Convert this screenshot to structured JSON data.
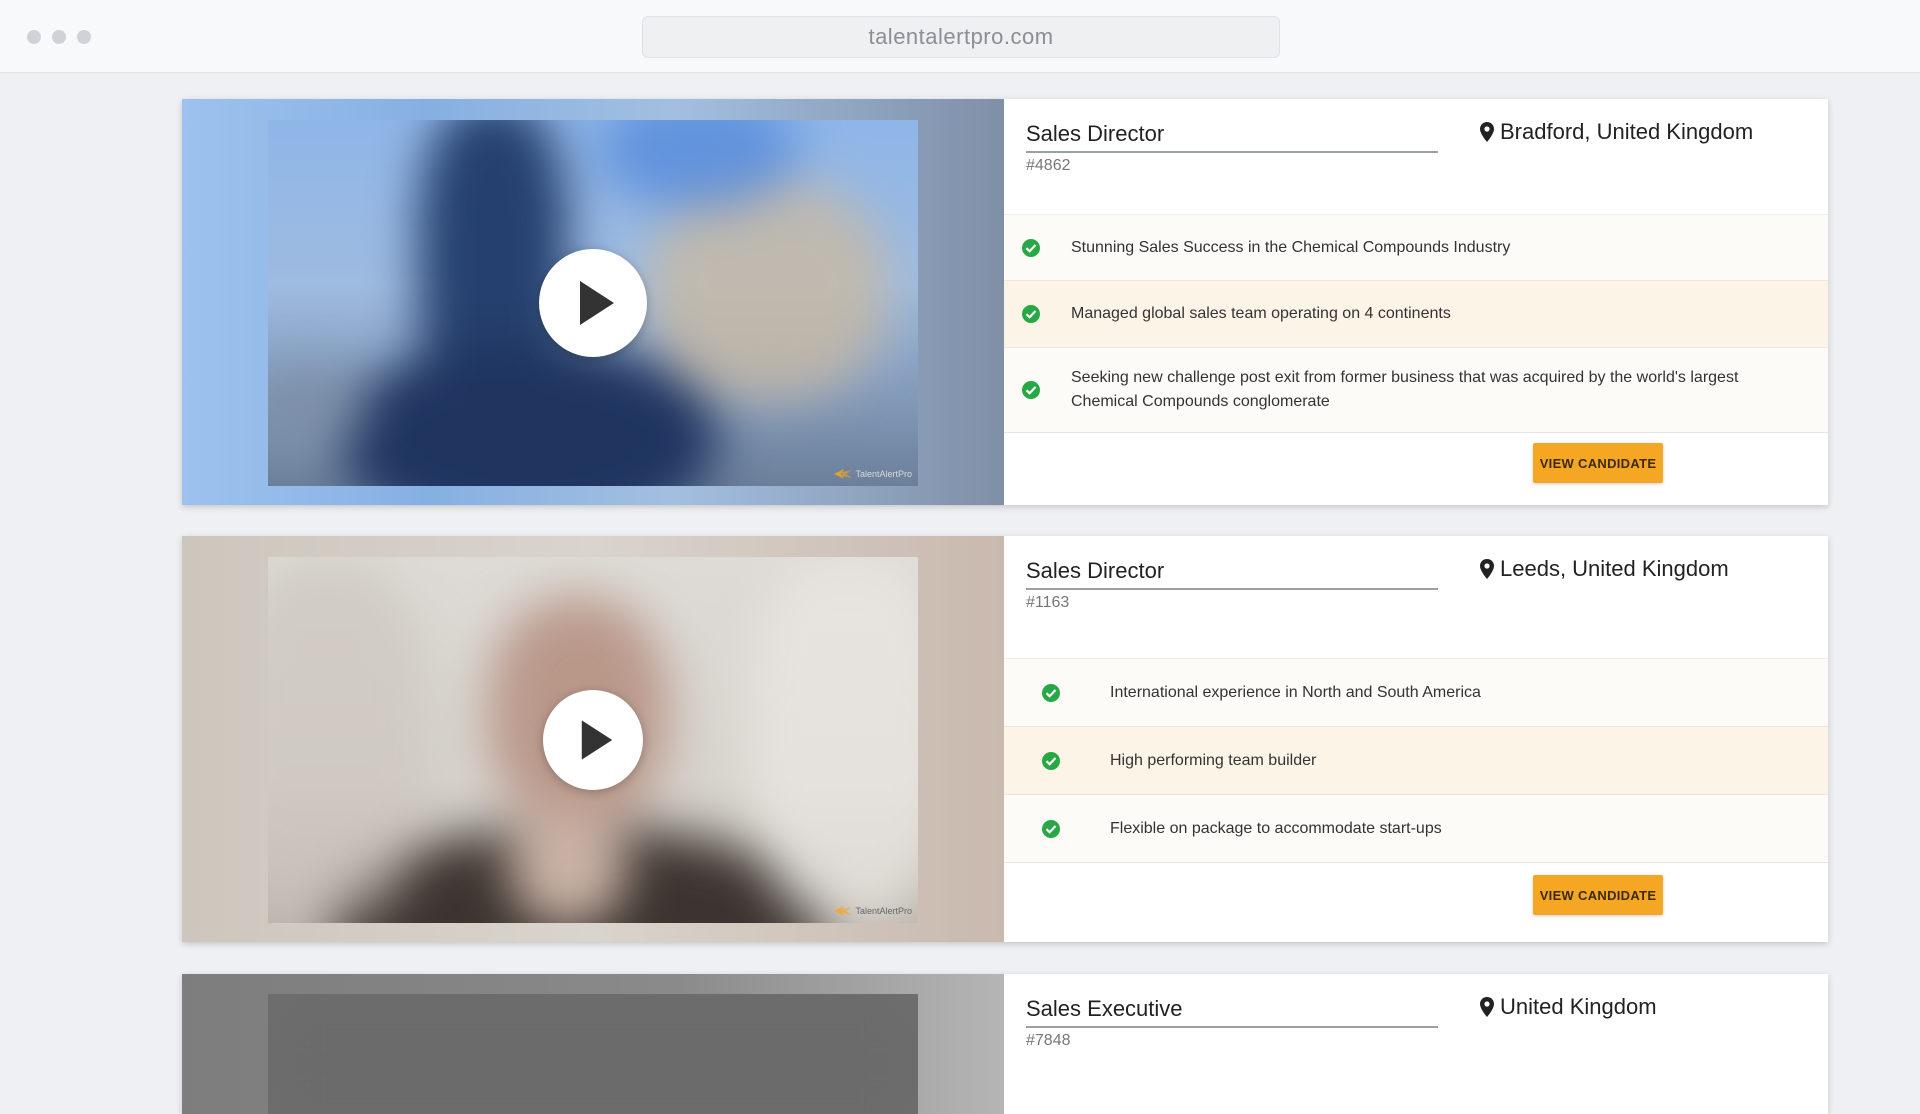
{
  "browser": {
    "url": "talentalertpro.com"
  },
  "candidates": [
    {
      "title": "Sales Director",
      "id": "#4862",
      "location": "Bradford, United Kingdom",
      "highlights": [
        "Stunning Sales Success in the Chemical Compounds Industry",
        "Managed global sales team operating on 4 continents",
        "Seeking new challenge post exit from former business that was acquired by the world's largest Chemical Compounds conglomerate"
      ],
      "button_label": "VIEW CANDIDATE",
      "watermark": "TalentAlertPro"
    },
    {
      "title": "Sales Director",
      "id": "#1163",
      "location": "Leeds, United Kingdom",
      "highlights": [
        "International experience in North and South America",
        "High performing team builder",
        "Flexible on package to accommodate start-ups"
      ],
      "button_label": "VIEW CANDIDATE",
      "watermark": "TalentAlertPro"
    },
    {
      "title": "Sales Executive",
      "id": "#7848",
      "location": "United Kingdom"
    }
  ],
  "colors": {
    "accent": "#f5a623",
    "check": "#27a844",
    "highlight_row": "#fdf4e8"
  }
}
